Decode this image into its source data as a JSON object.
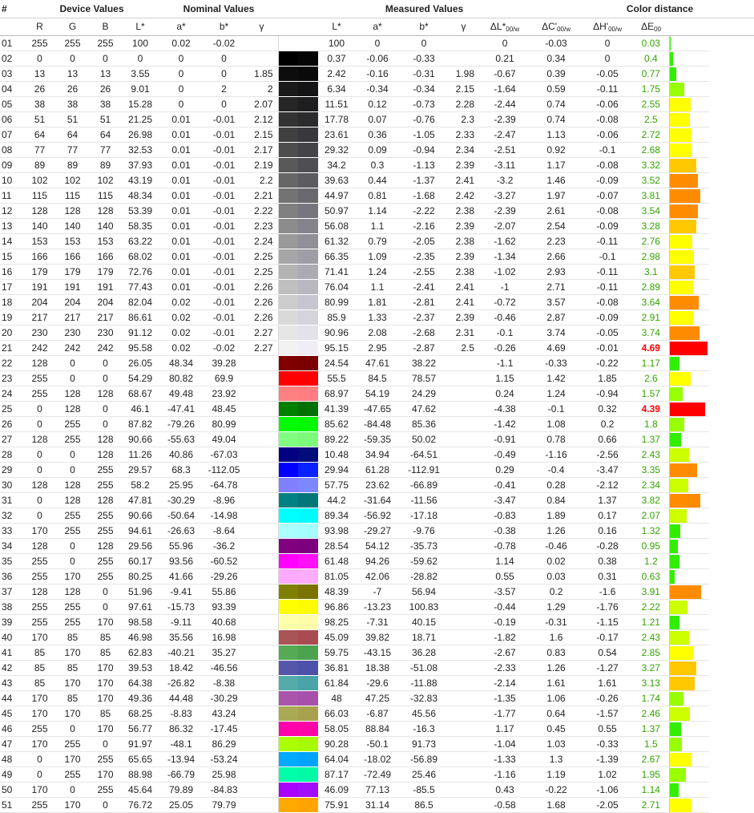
{
  "headers": {
    "num": "#",
    "device": "Device Values",
    "nominal": "Nominal Values",
    "measured": "Measured Values",
    "distance": "Color distance",
    "r": "R",
    "g": "G",
    "b": "B",
    "L": "L*",
    "a": "a*",
    "bstar": "b*",
    "gamma": "γ",
    "mL": "L*",
    "ma": "a*",
    "mb": "b*",
    "mgamma": "γ",
    "dL": "ΔL*",
    "dC": "ΔC'",
    "dH": "ΔH'",
    "dE": "ΔE",
    "sub_w": "00/w",
    "sub_00": "00"
  },
  "rows": [
    {
      "id": "01",
      "R": "255",
      "G": "255",
      "B": "255",
      "L": "100",
      "a": "0.02",
      "b": "-0.02",
      "g": "",
      "mL": "100",
      "ma": "0",
      "mb": "0",
      "mg": "",
      "dL": "0",
      "dC": "-0.03",
      "dH": "0",
      "dE": "0.03",
      "nom": "#ffffff",
      "meas": "#ffffff"
    },
    {
      "id": "02",
      "R": "0",
      "G": "0",
      "B": "0",
      "L": "0",
      "a": "0",
      "b": "0",
      "g": "",
      "mL": "0.37",
      "ma": "-0.06",
      "mb": "-0.33",
      "mg": "",
      "dL": "0.21",
      "dC": "0.34",
      "dH": "0",
      "dE": "0.4",
      "nom": "#000000",
      "meas": "#050505"
    },
    {
      "id": "03",
      "R": "13",
      "G": "13",
      "B": "13",
      "L": "3.55",
      "a": "0",
      "b": "0",
      "g": "1.85",
      "mL": "2.42",
      "ma": "-0.16",
      "mb": "-0.31",
      "mg": "1.98",
      "dL": "-0.67",
      "dC": "0.39",
      "dH": "-0.05",
      "dE": "0.77",
      "nom": "#0d0d0d",
      "meas": "#0a0a0b"
    },
    {
      "id": "04",
      "R": "26",
      "G": "26",
      "B": "26",
      "L": "9.01",
      "a": "0",
      "b": "2",
      "g": "2",
      "mL": "6.34",
      "ma": "-0.34",
      "mb": "-0.34",
      "mg": "2.15",
      "dL": "-1.64",
      "dC": "0.59",
      "dH": "-0.11",
      "dE": "1.75",
      "nom": "#1a1a1a",
      "meas": "#141416"
    },
    {
      "id": "05",
      "R": "38",
      "G": "38",
      "B": "38",
      "L": "15.28",
      "a": "0",
      "b": "0",
      "g": "2.07",
      "mL": "11.51",
      "ma": "0.12",
      "mb": "-0.73",
      "mg": "2.28",
      "dL": "-2.44",
      "dC": "0.74",
      "dH": "-0.06",
      "dE": "2.55",
      "nom": "#262626",
      "meas": "#1e1e21"
    },
    {
      "id": "06",
      "R": "51",
      "G": "51",
      "B": "51",
      "L": "21.25",
      "a": "0.01",
      "b": "-0.01",
      "g": "2.12",
      "mL": "17.78",
      "ma": "0.07",
      "mb": "-0.76",
      "mg": "2.3",
      "dL": "-2.39",
      "dC": "0.74",
      "dH": "-0.08",
      "dE": "2.5",
      "nom": "#333333",
      "meas": "#2b2b2e"
    },
    {
      "id": "07",
      "R": "64",
      "G": "64",
      "B": "64",
      "L": "26.98",
      "a": "0.01",
      "b": "-0.01",
      "g": "2.15",
      "mL": "23.61",
      "ma": "0.36",
      "mb": "-1.05",
      "mg": "2.33",
      "dL": "-2.47",
      "dC": "1.13",
      "dH": "-0.06",
      "dE": "2.72",
      "nom": "#404040",
      "meas": "#38383c"
    },
    {
      "id": "08",
      "R": "77",
      "G": "77",
      "B": "77",
      "L": "32.53",
      "a": "0.01",
      "b": "-0.01",
      "g": "2.17",
      "mL": "29.32",
      "ma": "0.09",
      "mb": "-0.94",
      "mg": "2.34",
      "dL": "-2.51",
      "dC": "0.92",
      "dH": "-0.1",
      "dE": "2.68",
      "nom": "#4d4d4d",
      "meas": "#444448"
    },
    {
      "id": "09",
      "R": "89",
      "G": "89",
      "B": "89",
      "L": "37.93",
      "a": "0.01",
      "b": "-0.01",
      "g": "2.19",
      "mL": "34.2",
      "ma": "0.3",
      "mb": "-1.13",
      "mg": "2.39",
      "dL": "-3.11",
      "dC": "1.17",
      "dH": "-0.08",
      "dE": "3.32",
      "nom": "#595959",
      "meas": "#4f4f53"
    },
    {
      "id": "10",
      "R": "102",
      "G": "102",
      "B": "102",
      "L": "43.19",
      "a": "0.01",
      "b": "-0.01",
      "g": "2.2",
      "mL": "39.63",
      "ma": "0.44",
      "mb": "-1.37",
      "mg": "2.41",
      "dL": "-3.2",
      "dC": "1.46",
      "dH": "-0.09",
      "dE": "3.52",
      "nom": "#666666",
      "meas": "#5b5b60"
    },
    {
      "id": "11",
      "R": "115",
      "G": "115",
      "B": "115",
      "L": "48.34",
      "a": "0.01",
      "b": "-0.01",
      "g": "2.21",
      "mL": "44.97",
      "ma": "0.81",
      "mb": "-1.68",
      "mg": "2.42",
      "dL": "-3.27",
      "dC": "1.97",
      "dH": "-0.07",
      "dE": "3.81",
      "nom": "#737373",
      "meas": "#68686e"
    },
    {
      "id": "12",
      "R": "128",
      "G": "128",
      "B": "128",
      "L": "53.39",
      "a": "0.01",
      "b": "-0.01",
      "g": "2.22",
      "mL": "50.97",
      "ma": "1.14",
      "mb": "-2.22",
      "mg": "2.38",
      "dL": "-2.39",
      "dC": "2.61",
      "dH": "-0.08",
      "dE": "3.54",
      "nom": "#808080",
      "meas": "#77767e"
    },
    {
      "id": "13",
      "R": "140",
      "G": "140",
      "B": "140",
      "L": "58.35",
      "a": "0.01",
      "b": "-0.01",
      "g": "2.23",
      "mL": "56.08",
      "ma": "1.1",
      "mb": "-2.16",
      "mg": "2.39",
      "dL": "-2.07",
      "dC": "2.54",
      "dH": "-0.09",
      "dE": "3.28",
      "nom": "#8c8c8c",
      "meas": "#84838b"
    },
    {
      "id": "14",
      "R": "153",
      "G": "153",
      "B": "153",
      "L": "63.22",
      "a": "0.01",
      "b": "-0.01",
      "g": "2.24",
      "mL": "61.32",
      "ma": "0.79",
      "mb": "-2.05",
      "mg": "2.38",
      "dL": "-1.62",
      "dC": "2.23",
      "dH": "-0.11",
      "dE": "2.76",
      "nom": "#999999",
      "meas": "#919098"
    },
    {
      "id": "15",
      "R": "166",
      "G": "166",
      "B": "166",
      "L": "68.02",
      "a": "0.01",
      "b": "-0.01",
      "g": "2.25",
      "mL": "66.35",
      "ma": "1.09",
      "mb": "-2.35",
      "mg": "2.39",
      "dL": "-1.34",
      "dC": "2.66",
      "dH": "-0.1",
      "dE": "2.98",
      "nom": "#a6a6a6",
      "meas": "#9f9ea6"
    },
    {
      "id": "16",
      "R": "179",
      "G": "179",
      "B": "179",
      "L": "72.76",
      "a": "0.01",
      "b": "-0.01",
      "g": "2.25",
      "mL": "71.41",
      "ma": "1.24",
      "mb": "-2.55",
      "mg": "2.38",
      "dL": "-1.02",
      "dC": "2.93",
      "dH": "-0.11",
      "dE": "3.1",
      "nom": "#b3b3b3",
      "meas": "#acabb4"
    },
    {
      "id": "17",
      "R": "191",
      "G": "191",
      "B": "191",
      "L": "77.43",
      "a": "0.01",
      "b": "-0.01",
      "g": "2.26",
      "mL": "76.04",
      "ma": "1.1",
      "mb": "-2.41",
      "mg": "2.41",
      "dL": "-1",
      "dC": "2.71",
      "dH": "-0.11",
      "dE": "2.89",
      "nom": "#bfbfbf",
      "meas": "#b9b8c0"
    },
    {
      "id": "18",
      "R": "204",
      "G": "204",
      "B": "204",
      "L": "82.04",
      "a": "0.02",
      "b": "-0.01",
      "g": "2.26",
      "mL": "80.99",
      "ma": "1.81",
      "mb": "-2.81",
      "mg": "2.41",
      "dL": "-0.72",
      "dC": "3.57",
      "dH": "-0.08",
      "dE": "3.64",
      "nom": "#cccccc",
      "meas": "#c7c5cf"
    },
    {
      "id": "19",
      "R": "217",
      "G": "217",
      "B": "217",
      "L": "86.61",
      "a": "0.02",
      "b": "-0.01",
      "g": "2.26",
      "mL": "85.9",
      "ma": "1.33",
      "mb": "-2.37",
      "mg": "2.39",
      "dL": "-0.46",
      "dC": "2.87",
      "dH": "-0.09",
      "dE": "2.91",
      "nom": "#d9d9d9",
      "meas": "#d5d4dc"
    },
    {
      "id": "20",
      "R": "230",
      "G": "230",
      "B": "230",
      "L": "91.12",
      "a": "0.02",
      "b": "-0.01",
      "g": "2.27",
      "mL": "90.96",
      "ma": "2.08",
      "mb": "-2.68",
      "mg": "2.31",
      "dL": "-0.1",
      "dC": "3.74",
      "dH": "-0.05",
      "dE": "3.74",
      "nom": "#e6e6e6",
      "meas": "#e3e1ea"
    },
    {
      "id": "21",
      "R": "242",
      "G": "242",
      "B": "242",
      "L": "95.58",
      "a": "0.02",
      "b": "-0.02",
      "g": "2.27",
      "mL": "95.15",
      "ma": "2.95",
      "mb": "-2.87",
      "mg": "2.5",
      "dL": "-0.26",
      "dC": "4.69",
      "dH": "-0.01",
      "dE": "4.69",
      "nom": "#f2f2f2",
      "meas": "#f1edf7"
    },
    {
      "id": "22",
      "R": "128",
      "G": "0",
      "B": "0",
      "L": "26.05",
      "a": "48.34",
      "b": "39.28",
      "g": "",
      "mL": "24.54",
      "ma": "47.61",
      "mb": "38.22",
      "mg": "",
      "dL": "-1.1",
      "dC": "-0.33",
      "dH": "-0.22",
      "dE": "1.17",
      "nom": "#800000",
      "meas": "#7a0000"
    },
    {
      "id": "23",
      "R": "255",
      "G": "0",
      "B": "0",
      "L": "54.29",
      "a": "80.82",
      "b": "69.9",
      "g": "",
      "mL": "55.5",
      "ma": "84.5",
      "mb": "78.57",
      "mg": "",
      "dL": "1.15",
      "dC": "1.42",
      "dH": "1.85",
      "dE": "2.6",
      "nom": "#ff0000",
      "meas": "#ff0000"
    },
    {
      "id": "24",
      "R": "255",
      "G": "128",
      "B": "128",
      "L": "68.67",
      "a": "49.48",
      "b": "23.92",
      "g": "",
      "mL": "68.97",
      "ma": "54.19",
      "mb": "24.29",
      "mg": "",
      "dL": "0.24",
      "dC": "1.24",
      "dH": "-0.94",
      "dE": "1.57",
      "nom": "#ff8080",
      "meas": "#ff7d80"
    },
    {
      "id": "25",
      "R": "0",
      "G": "128",
      "B": "0",
      "L": "46.1",
      "a": "-47.41",
      "b": "48.45",
      "g": "",
      "mL": "41.39",
      "ma": "-47.65",
      "mb": "47.62",
      "mg": "",
      "dL": "-4.38",
      "dC": "-0.1",
      "dH": "0.32",
      "dE": "4.39",
      "nom": "#008000",
      "meas": "#007100"
    },
    {
      "id": "26",
      "R": "0",
      "G": "255",
      "B": "0",
      "L": "87.82",
      "a": "-79.26",
      "b": "80.99",
      "g": "",
      "mL": "85.62",
      "ma": "-84.48",
      "mb": "85.36",
      "mg": "",
      "dL": "-1.42",
      "dC": "1.08",
      "dH": "0.2",
      "dE": "1.8",
      "nom": "#00ff00",
      "meas": "#00f900"
    },
    {
      "id": "27",
      "R": "128",
      "G": "255",
      "B": "128",
      "L": "90.66",
      "a": "-55.63",
      "b": "49.04",
      "g": "",
      "mL": "89.22",
      "ma": "-59.35",
      "mb": "50.02",
      "mg": "",
      "dL": "-0.91",
      "dC": "0.78",
      "dH": "0.66",
      "dE": "1.37",
      "nom": "#80ff80",
      "meas": "#7cfb7a"
    },
    {
      "id": "28",
      "R": "0",
      "G": "0",
      "B": "128",
      "L": "11.26",
      "a": "40.86",
      "b": "-67.03",
      "g": "",
      "mL": "10.48",
      "ma": "34.94",
      "mb": "-64.51",
      "mg": "",
      "dL": "-0.49",
      "dC": "-1.16",
      "dH": "-2.56",
      "dE": "2.43",
      "nom": "#000080",
      "meas": "#000c7a"
    },
    {
      "id": "29",
      "R": "0",
      "G": "0",
      "B": "255",
      "L": "29.57",
      "a": "68.3",
      "b": "-112.05",
      "g": "",
      "mL": "29.94",
      "ma": "61.28",
      "mb": "-112.91",
      "mg": "",
      "dL": "0.29",
      "dC": "-0.4",
      "dH": "-3.47",
      "dE": "3.35",
      "nom": "#0000ff",
      "meas": "#0a22ff"
    },
    {
      "id": "30",
      "R": "128",
      "G": "128",
      "B": "255",
      "L": "58.2",
      "a": "25.95",
      "b": "-64.78",
      "g": "",
      "mL": "57.75",
      "ma": "23.62",
      "mb": "-66.89",
      "mg": "",
      "dL": "-0.41",
      "dC": "0.28",
      "dH": "-2.12",
      "dE": "2.34",
      "nom": "#8080ff",
      "meas": "#7c88ff"
    },
    {
      "id": "31",
      "R": "0",
      "G": "128",
      "B": "128",
      "L": "47.81",
      "a": "-30.29",
      "b": "-8.96",
      "g": "",
      "mL": "44.2",
      "ma": "-31.64",
      "mb": "-11.56",
      "mg": "",
      "dL": "-3.47",
      "dC": "0.84",
      "dH": "1.37",
      "dE": "3.82",
      "nom": "#008080",
      "meas": "#007679"
    },
    {
      "id": "32",
      "R": "0",
      "G": "255",
      "B": "255",
      "L": "90.66",
      "a": "-50.64",
      "b": "-14.98",
      "g": "",
      "mL": "89.34",
      "ma": "-56.92",
      "mb": "-17.18",
      "mg": "",
      "dL": "-0.83",
      "dC": "1.89",
      "dH": "0.17",
      "dE": "2.07",
      "nom": "#00ffff",
      "meas": "#00fbff"
    },
    {
      "id": "33",
      "R": "170",
      "G": "255",
      "B": "255",
      "L": "94.61",
      "a": "-26.63",
      "b": "-8.64",
      "g": "",
      "mL": "93.98",
      "ma": "-29.27",
      "mb": "-9.76",
      "mg": "",
      "dL": "-0.38",
      "dC": "1.26",
      "dH": "0.16",
      "dE": "1.32",
      "nom": "#aaffff",
      "meas": "#a4fdfe"
    },
    {
      "id": "34",
      "R": "128",
      "G": "0",
      "B": "128",
      "L": "29.56",
      "a": "55.96",
      "b": "-36.2",
      "g": "",
      "mL": "28.54",
      "ma": "54.12",
      "mb": "-35.73",
      "mg": "",
      "dL": "-0.78",
      "dC": "-0.46",
      "dH": "-0.28",
      "dE": "0.95",
      "nom": "#800080",
      "meas": "#7c007d"
    },
    {
      "id": "35",
      "R": "255",
      "G": "0",
      "B": "255",
      "L": "60.17",
      "a": "93.56",
      "b": "-60.52",
      "g": "",
      "mL": "61.48",
      "ma": "94.26",
      "mb": "-59.62",
      "mg": "",
      "dL": "1.14",
      "dC": "0.02",
      "dH": "0.38",
      "dE": "1.2",
      "nom": "#ff00ff",
      "meas": "#ff10f7"
    },
    {
      "id": "36",
      "R": "255",
      "G": "170",
      "B": "255",
      "L": "80.25",
      "a": "41.66",
      "b": "-29.26",
      "g": "",
      "mL": "81.05",
      "ma": "42.06",
      "mb": "-28.82",
      "mg": "",
      "dL": "0.55",
      "dC": "0.03",
      "dH": "0.31",
      "dE": "0.63",
      "nom": "#ffaaff",
      "meas": "#ffacfc"
    },
    {
      "id": "37",
      "R": "128",
      "G": "128",
      "B": "0",
      "L": "51.96",
      "a": "-9.41",
      "b": "55.86",
      "g": "",
      "mL": "48.39",
      "ma": "-7",
      "mb": "56.94",
      "mg": "",
      "dL": "-3.57",
      "dC": "0.2",
      "dH": "-1.6",
      "dE": "3.91",
      "nom": "#808000",
      "meas": "#7a7300"
    },
    {
      "id": "38",
      "R": "255",
      "G": "255",
      "B": "0",
      "L": "97.61",
      "a": "-15.73",
      "b": "93.39",
      "g": "",
      "mL": "96.86",
      "ma": "-13.23",
      "mb": "100.83",
      "mg": "",
      "dL": "-0.44",
      "dC": "1.29",
      "dH": "-1.76",
      "dE": "2.22",
      "nom": "#ffff00",
      "meas": "#fffb00"
    },
    {
      "id": "39",
      "R": "255",
      "G": "255",
      "B": "170",
      "L": "98.58",
      "a": "-9.11",
      "b": "40.68",
      "g": "",
      "mL": "98.25",
      "ma": "-7.31",
      "mb": "40.15",
      "mg": "",
      "dL": "-0.19",
      "dC": "-0.31",
      "dH": "-1.15",
      "dE": "1.21",
      "nom": "#ffffaa",
      "meas": "#fffca9"
    },
    {
      "id": "40",
      "R": "170",
      "G": "85",
      "B": "85",
      "L": "46.98",
      "a": "35.56",
      "b": "16.98",
      "g": "",
      "mL": "45.09",
      "ma": "39.82",
      "mb": "18.71",
      "mg": "",
      "dL": "-1.82",
      "dC": "1.6",
      "dH": "-0.17",
      "dE": "2.43",
      "nom": "#aa5555",
      "meas": "#a84c51"
    },
    {
      "id": "41",
      "R": "85",
      "G": "170",
      "B": "85",
      "L": "62.83",
      "a": "-40.21",
      "b": "35.27",
      "g": "",
      "mL": "59.75",
      "ma": "-43.15",
      "mb": "36.28",
      "mg": "",
      "dL": "-2.67",
      "dC": "0.83",
      "dH": "0.54",
      "dE": "2.85",
      "nom": "#55aa55",
      "meas": "#4ca24f"
    },
    {
      "id": "42",
      "R": "85",
      "G": "85",
      "B": "170",
      "L": "39.53",
      "a": "18.42",
      "b": "-46.56",
      "g": "",
      "mL": "36.81",
      "ma": "18.38",
      "mb": "-51.08",
      "mg": "",
      "dL": "-2.33",
      "dC": "1.26",
      "dH": "-1.27",
      "dE": "3.27",
      "nom": "#5555aa",
      "meas": "#4d52a8"
    },
    {
      "id": "43",
      "R": "85",
      "G": "170",
      "B": "170",
      "L": "64.38",
      "a": "-26.82",
      "b": "-8.38",
      "g": "",
      "mL": "61.84",
      "ma": "-29.6",
      "mb": "-11.88",
      "mg": "",
      "dL": "-2.14",
      "dC": "1.61",
      "dH": "1.61",
      "dE": "3.13",
      "nom": "#55aaaa",
      "meas": "#4aa3a8"
    },
    {
      "id": "44",
      "R": "170",
      "G": "85",
      "B": "170",
      "L": "49.36",
      "a": "44.48",
      "b": "-30.29",
      "g": "",
      "mL": "48",
      "ma": "47.25",
      "mb": "-32.83",
      "mg": "",
      "dL": "-1.35",
      "dC": "1.06",
      "dH": "-0.26",
      "dE": "1.74",
      "nom": "#aa55aa",
      "meas": "#a650ab"
    },
    {
      "id": "45",
      "R": "170",
      "G": "170",
      "B": "85",
      "L": "68.25",
      "a": "-8.83",
      "b": "43.24",
      "g": "",
      "mL": "66.03",
      "ma": "-6.87",
      "mb": "45.56",
      "mg": "",
      "dL": "-1.77",
      "dC": "0.64",
      "dH": "-1.57",
      "dE": "2.46",
      "nom": "#aaaa55",
      "meas": "#a8a24e"
    },
    {
      "id": "46",
      "R": "255",
      "G": "0",
      "B": "170",
      "L": "56.77",
      "a": "86.32",
      "b": "-17.45",
      "g": "",
      "mL": "58.05",
      "ma": "88.84",
      "mb": "-16.3",
      "mg": "",
      "dL": "1.17",
      "dC": "0.45",
      "dH": "0.55",
      "dE": "1.37",
      "nom": "#ff00aa",
      "meas": "#ff05a8"
    },
    {
      "id": "47",
      "R": "170",
      "G": "255",
      "B": "0",
      "L": "91.97",
      "a": "-48.1",
      "b": "86.29",
      "g": "",
      "mL": "90.28",
      "ma": "-50.1",
      "mb": "91.73",
      "mg": "",
      "dL": "-1.04",
      "dC": "1.03",
      "dH": "-0.33",
      "dE": "1.5",
      "nom": "#aaff00",
      "meas": "#a6fb00"
    },
    {
      "id": "48",
      "R": "0",
      "G": "170",
      "B": "255",
      "L": "65.65",
      "a": "-13.94",
      "b": "-53.24",
      "g": "",
      "mL": "64.04",
      "ma": "-18.02",
      "mb": "-56.89",
      "mg": "",
      "dL": "-1.33",
      "dC": "1.3",
      "dH": "-1.39",
      "dE": "2.67",
      "nom": "#00aaff",
      "meas": "#00a4ff"
    },
    {
      "id": "49",
      "R": "0",
      "G": "255",
      "B": "170",
      "L": "88.98",
      "a": "-66.79",
      "b": "25.98",
      "g": "",
      "mL": "87.17",
      "ma": "-72.49",
      "mb": "25.46",
      "mg": "",
      "dL": "-1.16",
      "dC": "1.19",
      "dH": "1.02",
      "dE": "1.95",
      "nom": "#00ffaa",
      "meas": "#00fba6"
    },
    {
      "id": "50",
      "R": "170",
      "G": "0",
      "B": "255",
      "L": "45.64",
      "a": "79.89",
      "b": "-84.83",
      "g": "",
      "mL": "46.09",
      "ma": "77.13",
      "mb": "-85.5",
      "mg": "",
      "dL": "0.43",
      "dC": "-0.22",
      "dH": "-1.06",
      "dE": "1.14",
      "nom": "#aa00ff",
      "meas": "#a20dff"
    },
    {
      "id": "51",
      "R": "255",
      "G": "170",
      "B": "0",
      "L": "76.72",
      "a": "25.05",
      "b": "79.79",
      "g": "",
      "mL": "75.91",
      "ma": "31.14",
      "mb": "86.5",
      "mg": "",
      "dL": "-0.58",
      "dC": "1.68",
      "dH": "-2.05",
      "dE": "2.71",
      "nom": "#ffaa00",
      "meas": "#ffa400"
    }
  ]
}
